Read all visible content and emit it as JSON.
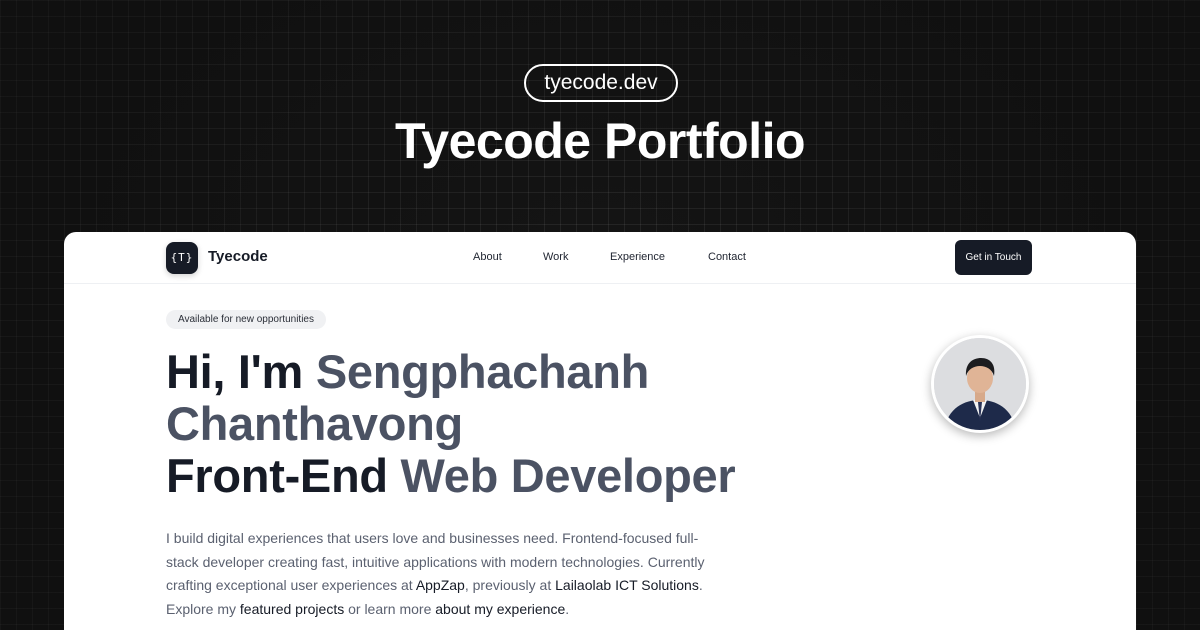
{
  "banner": {
    "domain": "tyecode.dev",
    "title": "Tyecode Portfolio"
  },
  "nav": {
    "logo_text": "{T}",
    "brand": "Tyecode",
    "links": [
      "About",
      "Work",
      "Experience",
      "Contact"
    ],
    "cta": "Get in Touch"
  },
  "hero": {
    "badge": "Available for new opportunities",
    "greeting": "Hi, I'm ",
    "first_name": "Sengphachanh",
    "last_name": "Chanthavong",
    "role_strong": "Front-End",
    "role_soft": " Web Developer",
    "intro": {
      "p1": "I build digital experiences that users love and businesses need. Frontend-focused full-stack developer creating fast, intuitive applications with modern technologies. Currently crafting exceptional user experiences at ",
      "company_current": "AppZap",
      "p2": ", previously at ",
      "company_previous": "Lailaolab ICT Solutions",
      "p3": ". Explore my ",
      "link_projects": "featured projects",
      "p4": " or learn more ",
      "link_experience": "about my experience",
      "p5": "."
    }
  },
  "icons": {
    "avatar": "profile-photo"
  },
  "colors": {
    "background": "#141414",
    "card": "#ffffff",
    "primary": "#161b26",
    "muted_heading": "#4b5263",
    "body_text": "#5b6170"
  }
}
